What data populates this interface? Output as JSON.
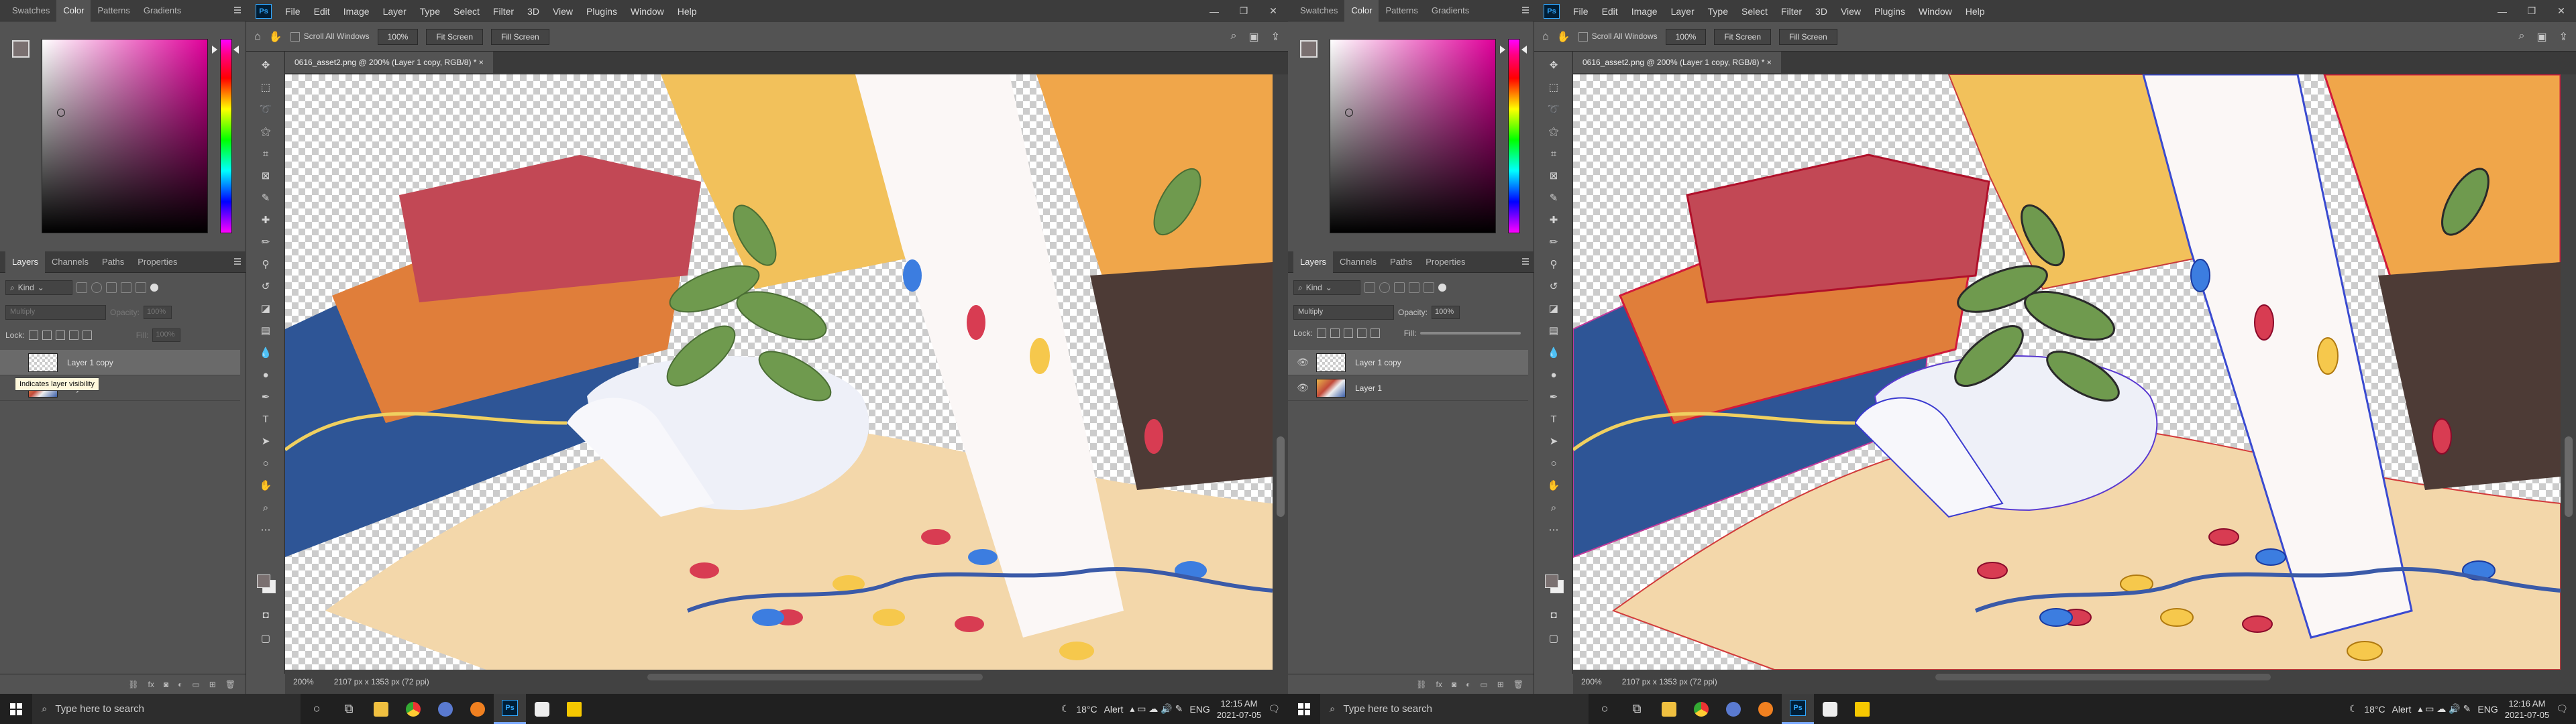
{
  "panels": {
    "color_tabs": [
      "Swatches",
      "Color",
      "Patterns",
      "Gradients"
    ],
    "color_active": "Color",
    "layers_tabs": [
      "Layers",
      "Channels",
      "Paths",
      "Properties"
    ],
    "layers_active": "Layers",
    "kind_label": "Kind",
    "blend_mode": "Multiply",
    "opacity_label": "Opacity:",
    "opacity_value": "100%",
    "lock_label": "Lock:",
    "fill_label": "Fill:",
    "fill_value": "100%",
    "layers": [
      {
        "name": "Layer 1 copy",
        "selected": true
      },
      {
        "name": "Layer 1",
        "selected": false
      }
    ],
    "tooltip": "Indicates layer visibility",
    "bottom_icons": [
      "link-icon",
      "fx",
      "mask-icon",
      "adjustment-icon",
      "group-icon",
      "new-layer-icon",
      "trash-icon"
    ],
    "fx_label": "fx"
  },
  "app": {
    "logo": "Ps",
    "menus": [
      "File",
      "Edit",
      "Image",
      "Layer",
      "Type",
      "Select",
      "Filter",
      "3D",
      "View",
      "Plugins",
      "Window",
      "Help"
    ],
    "options": {
      "scroll_all_windows": "Scroll All Windows",
      "zoom": "100%",
      "fit_screen": "Fit Screen",
      "fill_screen": "Fill Screen"
    },
    "doc_tab": "0616_asset2.png @ 200% (Layer 1 copy, RGB/8) *",
    "status_zoom": "200%",
    "status_info": "2107 px x 1353 px (72 ppi)"
  },
  "taskbar": {
    "search_placeholder": "Type here to search",
    "weather": "18°C",
    "alert": "Alert",
    "language": "ENG",
    "left_time": "12:15 AM",
    "right_time": "12:16 AM",
    "date": "2021-07-05"
  },
  "colors": {
    "ps_blue": "#31a8ff",
    "panel_bg": "#535353",
    "menu_bg": "#3c3c3c",
    "picker_hue": "#e0009a",
    "taskbar_bg": "#202020"
  },
  "left_screen": {
    "blend_mode_enabled": false,
    "tooltip_visible": true
  },
  "right_screen": {
    "blend_mode_enabled": true,
    "tooltip_visible": false,
    "outlines_visible": true
  }
}
